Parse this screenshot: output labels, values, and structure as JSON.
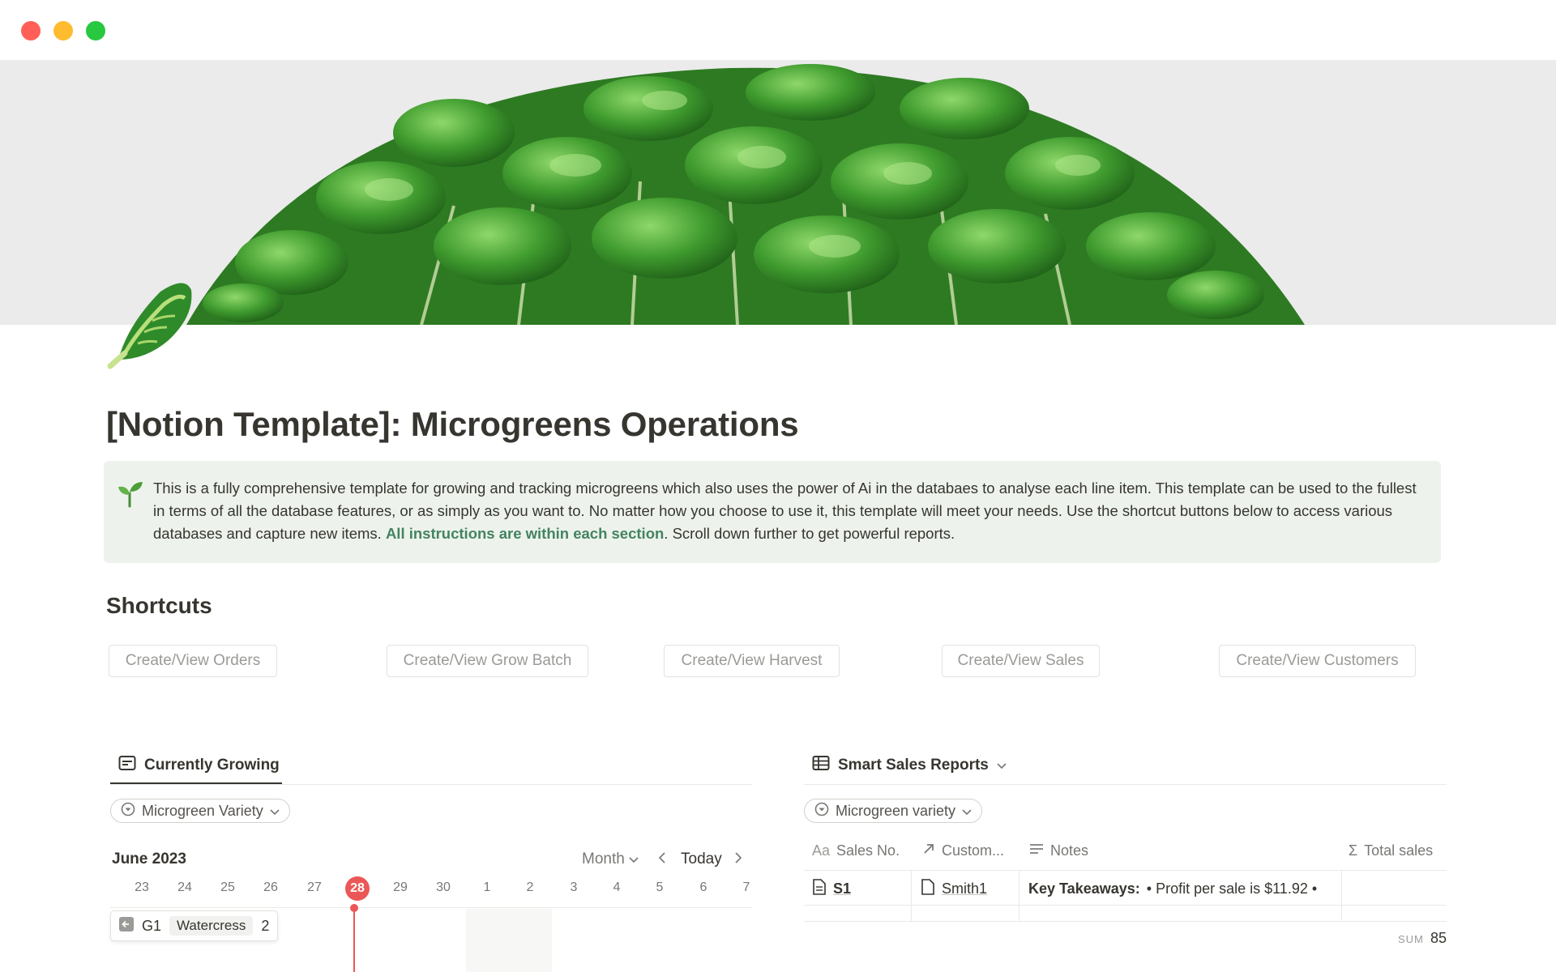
{
  "page": {
    "title": "[Notion Template]: Microgreens Operations",
    "icon": "lettuce-icon"
  },
  "callout": {
    "icon": "seedling-icon",
    "text_before": "This is a fully comprehensive template for growing and tracking microgreens which also uses the power of Ai in the databaes to analyse each line item. This template can be used to the fullest in terms of all the database features, or as simply as you want to. No matter how you choose to use it, this template will meet your needs. Use the shortcut buttons below to access various databases and capture new items.",
    "link_text": "All instructions are within each section",
    "text_after": ". Scroll down further to get powerful reports."
  },
  "shortcuts": {
    "heading": "Shortcuts",
    "buttons": [
      "Create/View Orders",
      "Create/View Grow Batch",
      "Create/View Harvest",
      "Create/View Sales",
      "Create/View Customers"
    ]
  },
  "growing": {
    "tab_label": "Currently Growing",
    "filter_label": "Microgreen Variety",
    "month_label": "June 2023",
    "view_label": "Month",
    "today_label": "Today",
    "days": [
      "23",
      "24",
      "25",
      "26",
      "27",
      "28",
      "29",
      "30",
      "1",
      "2",
      "3",
      "4",
      "5",
      "6",
      "7"
    ],
    "today_day": "28",
    "card": {
      "id": "G1",
      "variety": "Watercress",
      "count": "2"
    }
  },
  "sales": {
    "tab_label": "Smart Sales Reports",
    "filter_label": "Microgreen variety",
    "columns": {
      "sales_no": "Sales No.",
      "customer": "Custom...",
      "notes": "Notes",
      "total": "Total sales"
    },
    "column_prefix": "Aa",
    "row": {
      "sales_no": "S1",
      "customer": "Smith1",
      "notes_bold": "Key Takeaways:",
      "notes_text": "• Profit per sale is $11.92 •"
    },
    "sum_label": "SUM",
    "sum_value": "85"
  },
  "colors": {
    "callout_bg": "#edf3ec",
    "link_green": "#448361",
    "today_red": "#eb5757"
  }
}
